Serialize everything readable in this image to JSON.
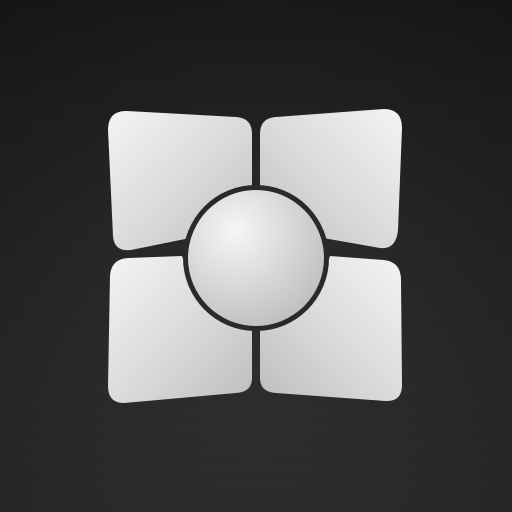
{
  "icon": {
    "semantic_name": "four-petal-flower-logo-icon",
    "parts": [
      "petal-top-left",
      "petal-top-right",
      "petal-bottom-left",
      "petal-bottom-right",
      "center-circle"
    ]
  },
  "colors": {
    "background_top": "#1f1f1f",
    "background_bottom": "#3a3a3a",
    "petal_light": "#f4f4f4",
    "petal_mid": "#d9d9d9",
    "petal_dark": "#bdbdbd",
    "circle_light": "#f6f6f6",
    "circle_dark": "#b8b8b8",
    "outline": "#2a2a2a"
  }
}
